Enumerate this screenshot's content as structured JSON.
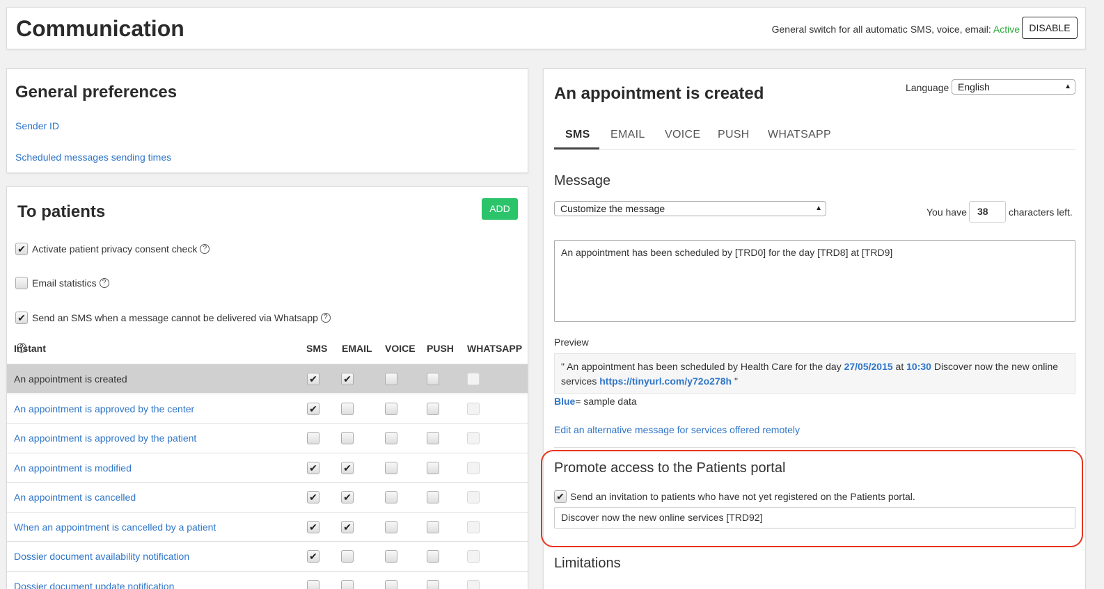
{
  "header": {
    "title": "Communication",
    "switch_label": "General switch for all automatic SMS, voice, email:",
    "switch_status": "Active",
    "disable_label": "DISABLE"
  },
  "general_preferences": {
    "title": "General preferences",
    "links": [
      "Sender ID",
      "Scheduled messages sending times"
    ]
  },
  "patients": {
    "title": "To patients",
    "add_label": "ADD",
    "options": [
      {
        "label": "Activate patient privacy consent check",
        "checked": true
      },
      {
        "label": "Email statistics",
        "checked": false
      },
      {
        "label": "Send an SMS when a message cannot be delivered via Whatsapp",
        "checked": true
      }
    ],
    "columns": [
      "Instant",
      "SMS",
      "EMAIL",
      "VOICE",
      "PUSH",
      "WHATSAPP"
    ],
    "rows": [
      {
        "name": "An appointment is created",
        "selected": true,
        "sms": true,
        "email": true,
        "voice": false,
        "push": false
      },
      {
        "name": "An appointment is approved by the center",
        "selected": false,
        "sms": true,
        "email": false,
        "voice": false,
        "push": false
      },
      {
        "name": "An appointment is approved by the patient",
        "selected": false,
        "sms": false,
        "email": false,
        "voice": false,
        "push": false
      },
      {
        "name": "An appointment is modified",
        "selected": false,
        "sms": true,
        "email": true,
        "voice": false,
        "push": false
      },
      {
        "name": "An appointment is cancelled",
        "selected": false,
        "sms": true,
        "email": true,
        "voice": false,
        "push": false
      },
      {
        "name": "When an appointment is cancelled by a patient",
        "selected": false,
        "sms": true,
        "email": true,
        "voice": false,
        "push": false
      },
      {
        "name": "Dossier document availability notification",
        "selected": false,
        "sms": true,
        "email": false,
        "voice": false,
        "push": false
      },
      {
        "name": "Dossier document update notification",
        "selected": false,
        "sms": false,
        "email": false,
        "voice": false,
        "push": false
      }
    ]
  },
  "detail": {
    "title": "An appointment is created",
    "language_label": "Language",
    "language_value": "English",
    "tabs": [
      "SMS",
      "EMAIL",
      "VOICE",
      "PUSH",
      "WHATSAPP"
    ],
    "active_tab": "SMS",
    "message_title": "Message",
    "message_mode": "Customize the message",
    "chars_prefix": "You have",
    "chars_left": "38",
    "chars_suffix": "characters left.",
    "message_text": "An appointment has been scheduled by [TRD0] for the day [TRD8] at [TRD9]",
    "preview_label": "Preview",
    "preview": {
      "part1": "\" An appointment has been scheduled by Health Care for the day ",
      "date": "27/05/2015",
      "part2": " at ",
      "time": "10:30",
      "part3": " Discover now the new online services ",
      "url": "https://tinyurl.com/y72o278h",
      "part4": " \""
    },
    "legend_blue": "Blue",
    "legend_text": "= sample data",
    "alt_link": "Edit an alternative message for services offered remotely",
    "promote_title": "Promote access to the Patients portal",
    "invite_label": "Send an invitation to patients who have not yet registered on the Patients portal.",
    "invite_checked": true,
    "invite_text": "Discover now the new online services [TRD92]",
    "limitations_title": "Limitations"
  }
}
